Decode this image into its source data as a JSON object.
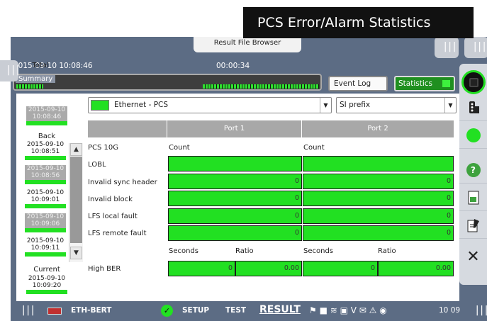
{
  "banner": {
    "title": "PCS Error/Alarm Statistics"
  },
  "top": {
    "file_browser_tab": "Result File Browser",
    "datetime": "2015-09-10 10:08:46",
    "elapsed": "00:00:34",
    "summary_label": "Summary",
    "event_log_button": "Event Log",
    "statistics_button": "Statistics"
  },
  "history": {
    "total_label": "Total",
    "total_entry": [
      "2015-09-10",
      "10:08:46"
    ],
    "back_label": "Back",
    "back_entries": [
      [
        "2015-09-10",
        "10:08:51"
      ],
      [
        "2015-09-10",
        "10:08:56"
      ],
      [
        "2015-09-10",
        "10:09:01"
      ],
      [
        "2015-09-10",
        "10:09:06"
      ],
      [
        "2015-09-10",
        "10:09:11"
      ]
    ],
    "current_label": "Current",
    "current_entry": [
      "2015-09-10",
      "10:09:20"
    ]
  },
  "selectors": {
    "interface": "Ethernet - PCS",
    "prefix": "SI prefix"
  },
  "table": {
    "port1_header": "Port 1",
    "port2_header": "Port 2",
    "section_label": "PCS 10G",
    "count_header": "Count",
    "rows": [
      {
        "label": "LOBL",
        "port1": "",
        "port2": ""
      },
      {
        "label": "Invalid sync header",
        "port1": "0",
        "port2": "0"
      },
      {
        "label": "Invalid block",
        "port1": "0",
        "port2": "0"
      },
      {
        "label": "LFS local fault",
        "port1": "0",
        "port2": "0"
      },
      {
        "label": "LFS remote fault",
        "port1": "0",
        "port2": "0"
      }
    ],
    "seconds_header": "Seconds",
    "ratio_header": "Ratio",
    "ber_row": {
      "label": "High BER",
      "port1_seconds": "0",
      "port1_ratio": "0.00",
      "port2_seconds": "0",
      "port2_ratio": "0.00"
    }
  },
  "bottom": {
    "app_name": "ETH-BERT",
    "setup": "SETUP",
    "test": "TEST",
    "result": "RESULT",
    "clock": "10 09"
  },
  "colors": {
    "status_green": "#22e022",
    "chrome": "#5c6c84"
  },
  "icons": [
    "stop-icon",
    "traffic-light-icon",
    "help-icon",
    "report-icon",
    "edit-icon",
    "close-icon"
  ]
}
